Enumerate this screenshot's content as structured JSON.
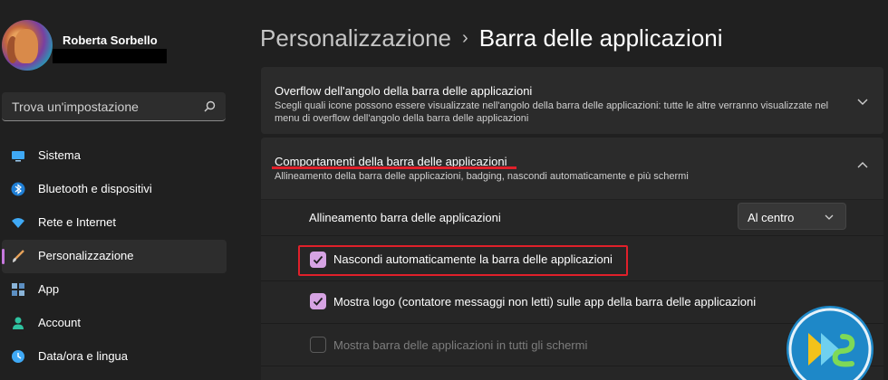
{
  "user": {
    "name": "Roberta Sorbello"
  },
  "search": {
    "placeholder": "Trova un'impostazione"
  },
  "nav": [
    {
      "label": "Sistema",
      "icon": "monitor-icon"
    },
    {
      "label": "Bluetooth e dispositivi",
      "icon": "bluetooth-icon"
    },
    {
      "label": "Rete e Internet",
      "icon": "wifi-icon"
    },
    {
      "label": "Personalizzazione",
      "icon": "brush-icon",
      "active": true
    },
    {
      "label": "App",
      "icon": "apps-icon"
    },
    {
      "label": "Account",
      "icon": "person-icon"
    },
    {
      "label": "Data/ora e lingua",
      "icon": "globe-clock-icon"
    }
  ],
  "breadcrumb": {
    "parent": "Personalizzazione",
    "separator": "›",
    "current": "Barra delle applicazioni"
  },
  "sections": {
    "overflow": {
      "title": "Overflow dell'angolo della barra delle applicazioni",
      "desc1": "Scegli quali icone possono essere visualizzate nell'angolo della barra delle applicazioni: tutte le altre verranno visualizzate nel",
      "desc2": "menu di overflow dell'angolo della barra delle applicazioni"
    },
    "behaviors": {
      "title": "Comportamenti della barra delle applicazioni",
      "desc": "Allineamento della barra delle applicazioni, badging, nascondi automaticamente e più schermi"
    }
  },
  "settings": {
    "alignment": {
      "label": "Allineamento barra delle applicazioni",
      "value": "Al centro"
    },
    "autohide": {
      "label": "Nascondi automaticamente la barra delle applicazioni",
      "checked": true
    },
    "badges": {
      "label": "Mostra logo (contatore messaggi non letti) sulle app della barra delle applicazioni",
      "checked": true
    },
    "multi": {
      "label": "Mostra barra delle applicazioni in tutti gli schermi",
      "checked": false,
      "disabled": true
    }
  },
  "colors": {
    "accent": "#c678dd",
    "checkbox": "#d6a3e3",
    "highlight": "#e0202a",
    "background": "#202020",
    "card": "#2b2b2b"
  }
}
